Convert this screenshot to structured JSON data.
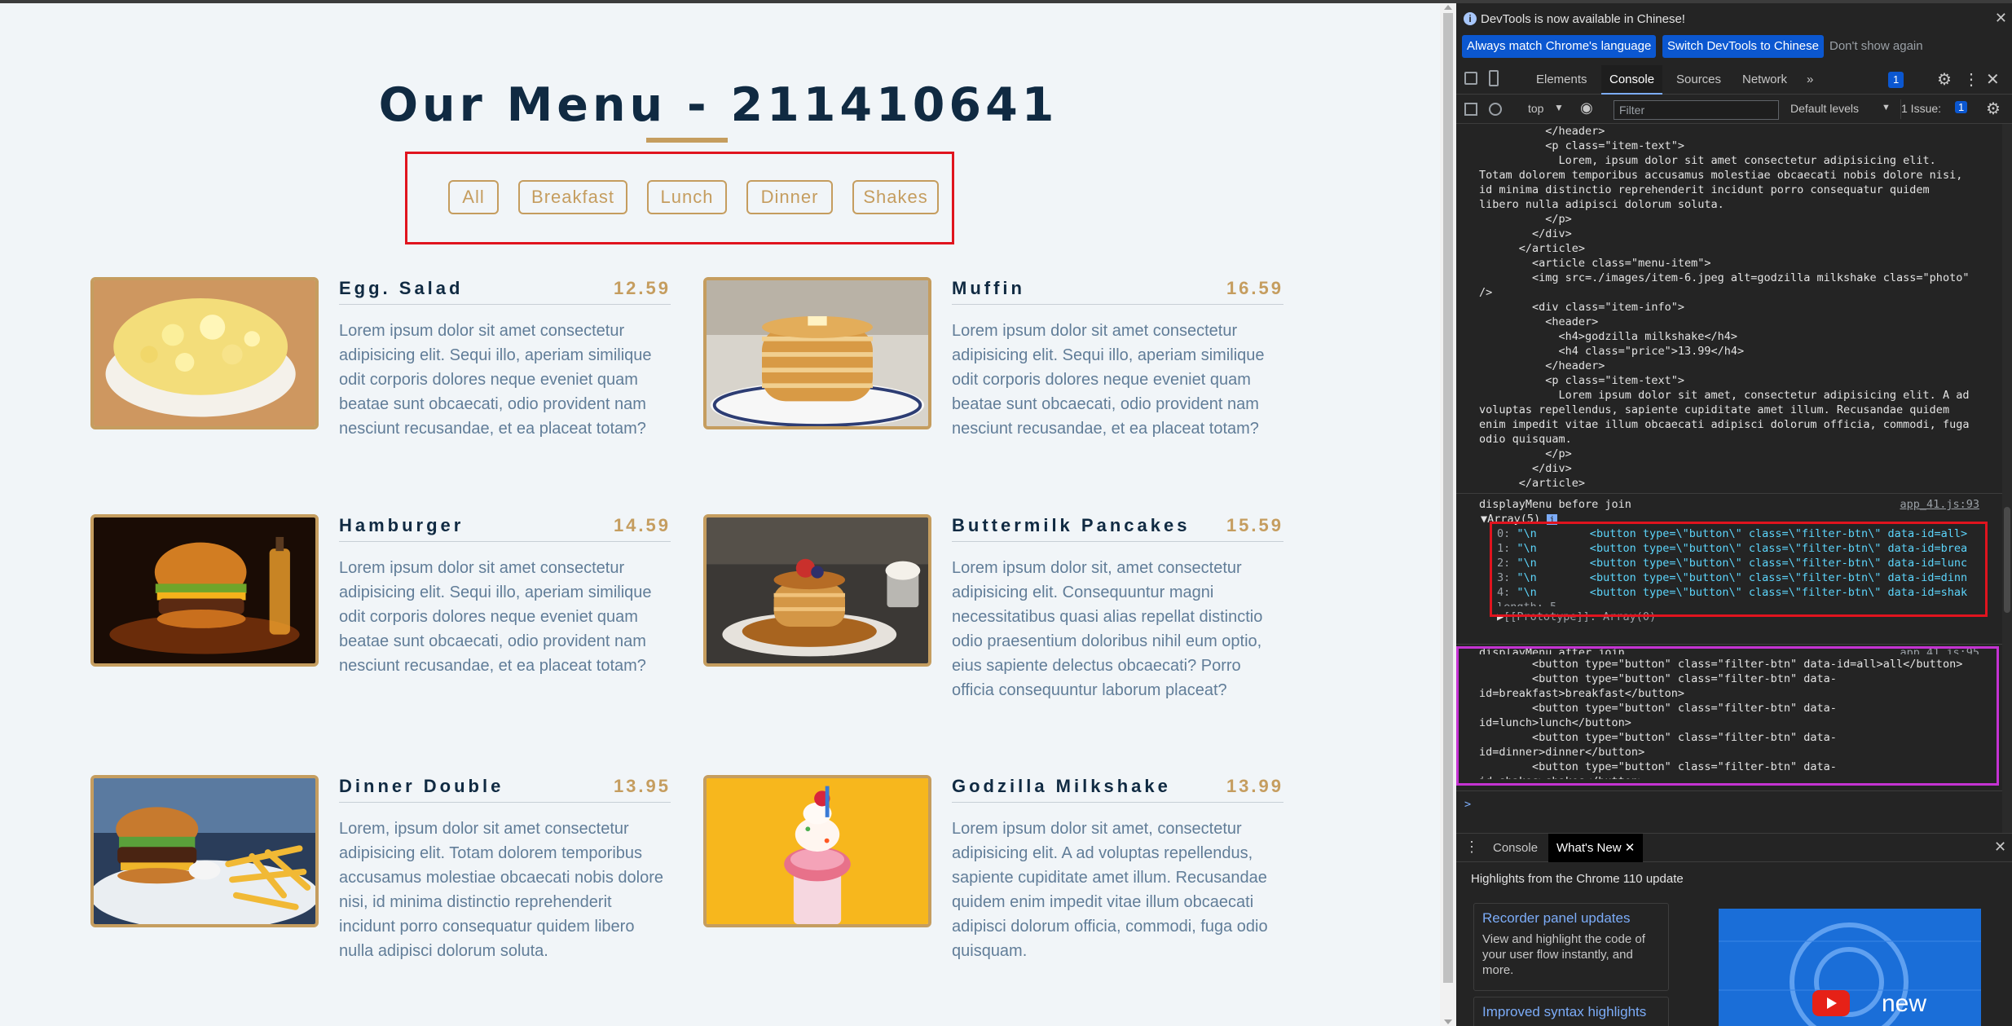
{
  "page": {
    "title": "Our Menu - 211410641",
    "filters": [
      "All",
      "Breakfast",
      "Lunch",
      "Dinner",
      "Shakes"
    ],
    "items": [
      {
        "name": "Egg. Salad",
        "price": "12.59",
        "text": "Lorem ipsum dolor sit amet consectetur adipisicing elit. Sequi illo, aperiam similique odit corporis dolores neque eveniet quam beatae sunt obcaecati, odio provident nam nesciunt recusandae, et ea placeat totam?"
      },
      {
        "name": "Muffin",
        "price": "16.59",
        "text": "Lorem ipsum dolor sit amet consectetur adipisicing elit. Sequi illo, aperiam similique odit corporis dolores neque eveniet quam beatae sunt obcaecati, odio provident nam nesciunt recusandae, et ea placeat totam?"
      },
      {
        "name": "Hamburger",
        "price": "14.59",
        "text": "Lorem ipsum dolor sit amet consectetur adipisicing elit. Sequi illo, aperiam similique odit corporis dolores neque eveniet quam beatae sunt obcaecati, odio provident nam nesciunt recusandae, et ea placeat totam?"
      },
      {
        "name": "Buttermilk Pancakes",
        "price": "15.59",
        "text": "Lorem ipsum dolor sit, amet consectetur adipisicing elit. Consequuntur magni necessitatibus quasi alias repellat distinctio odio praesentium doloribus nihil eum optio, eius sapiente delectus obcaecati? Porro officia consequuntur laborum placeat?"
      },
      {
        "name": "Dinner Double",
        "price": "13.95",
        "text": "Lorem, ipsum dolor sit amet consectetur adipisicing elit. Totam dolorem temporibus accusamus molestiae obcaecati nobis dolore nisi, id minima distinctio reprehenderit incidunt porro consequatur quidem libero nulla adipisci dolorum soluta."
      },
      {
        "name": "Godzilla Milkshake",
        "price": "13.99",
        "text": "Lorem ipsum dolor sit amet, consectetur adipisicing elit. A ad voluptas repellendus, sapiente cupiditate amet illum. Recusandae quidem enim impedit vitae illum obcaecati adipisci dolorum officia, commodi, fuga odio quisquam."
      }
    ]
  },
  "devtools": {
    "banner": "DevTools is now available in Chinese!",
    "banner_buttons": [
      "Always match Chrome's language",
      "Switch DevTools to Chinese",
      "Don't show again"
    ],
    "tabs": [
      "Elements",
      "Console",
      "Sources",
      "Network"
    ],
    "issues_badge": "1",
    "context": "top",
    "filter_placeholder": "Filter",
    "levels": "Default levels",
    "issue_label": "1 Issue:",
    "issue_count": "1",
    "html_dump": "          </header>\n          <p class=\"item-text\">\n            Lorem, ipsum dolor sit amet consectetur adipisicing elit.\nTotam dolorem temporibus accusamus molestiae obcaecati nobis dolore nisi,\nid minima distinctio reprehenderit incidunt porro consequatur quidem\nlibero nulla adipisci dolorum soluta.\n          </p>\n        </div>\n      </article>\n        <article class=\"menu-item\">\n        <img src=./images/item-6.jpeg alt=godzilla milkshake class=\"photo\"\n/>\n        <div class=\"item-info\">\n          <header>\n            <h4>godzilla milkshake</h4>\n            <h4 class=\"price\">13.99</h4>\n          </header>\n          <p class=\"item-text\">\n            Lorem ipsum dolor sit amet, consectetur adipisicing elit. A ad\nvoluptas repellendus, sapiente cupiditate amet illum. Recusandae quidem\nenim impedit vitae illum obcaecati adipisci dolorum officia, commodi, fuga\nodio quisquam.\n          </p>\n        </div>\n      </article>",
    "log1_label": "displayMenu before join",
    "log1_src": "app_41.js:93",
    "array_label": "Array(5)",
    "array_items": [
      {
        "key": "0:",
        "val": "\"\\n        <button type=\\\"button\\\" class=\\\"filter-btn\\\" data-id=all>"
      },
      {
        "key": "1:",
        "val": "\"\\n        <button type=\\\"button\\\" class=\\\"filter-btn\\\" data-id=brea"
      },
      {
        "key": "2:",
        "val": "\"\\n        <button type=\\\"button\\\" class=\\\"filter-btn\\\" data-id=lunc"
      },
      {
        "key": "3:",
        "val": "\"\\n        <button type=\\\"button\\\" class=\\\"filter-btn\\\" data-id=dinn"
      },
      {
        "key": "4:",
        "val": "\"\\n        <button type=\\\"button\\\" class=\\\"filter-btn\\\" data-id=shak"
      }
    ],
    "length_label": "length: 5",
    "prototype_label": "[[Prototype]]: Array(0)",
    "log2_label": "displayMenu after join",
    "log2_src": "app_41.js:95",
    "join_dump": "        <button type=\"button\" class=\"filter-btn\" data-id=all>all</button>\n        <button type=\"button\" class=\"filter-btn\" data-\nid=breakfast>breakfast</button>\n        <button type=\"button\" class=\"filter-btn\" data-\nid=lunch>lunch</button>\n        <button type=\"button\" class=\"filter-btn\" data-\nid=dinner>dinner</button>\n        <button type=\"button\" class=\"filter-btn\" data-\nid=shakes>shakes</button>",
    "prompt": ">",
    "drawer_tabs": [
      "Console",
      "What's New"
    ],
    "highlights": "Highlights from the Chrome 110 update",
    "cards": [
      {
        "title": "Recorder panel updates",
        "desc": "View and highlight the code of your user flow instantly, and more."
      },
      {
        "title": "Improved syntax highlights",
        "desc": ""
      }
    ],
    "promo_text": "new"
  }
}
